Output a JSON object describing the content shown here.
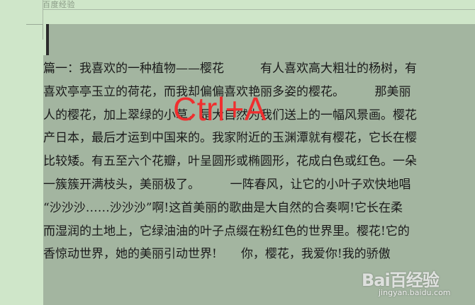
{
  "header": {
    "watermark": "百度经验"
  },
  "document": {
    "lines": [
      "篇一：我喜欢的一种植物——樱花　　　有人喜欢高大粗壮的杨树，有",
      "喜欢亭亭玉立的荷花，而我却偏偏喜欢艳丽多姿的樱花。　　　那美丽",
      "人的樱花，加上翠绿的小草，是大自然为我们送上的一幅风景画。樱花",
      "产日本，最后才运到中国来的。我家附近的玉渊潭就有樱花，它长在樱",
      "比较矮。有五至六个花瓣，叶呈圆形或椭圆形，花成白色或红色。一朵",
      "一簇簇开满枝头，美丽极了。　　　一阵春风，让它的小叶子欢快地唱",
      "“沙沙沙……沙沙沙”啊!这首美丽的歌曲是大自然的合奏啊!它长在柔",
      "而湿润的土地上，它绿油油的叶子点缀在粉红色的世界里。樱花!它的",
      "香惊动世界，她的美丽引动世界!　　你，樱花，我爱你!我的骄傲"
    ]
  },
  "overlay": {
    "shortcut": "Ctrl+A"
  },
  "watermark_logo": {
    "name": "Bai百经验",
    "url": "jingyan.baidu.com"
  },
  "colors": {
    "page_background": "#cfe6c9",
    "selection_highlight": "#a3b5a0",
    "shortcut_text": "#ef2f2f"
  }
}
